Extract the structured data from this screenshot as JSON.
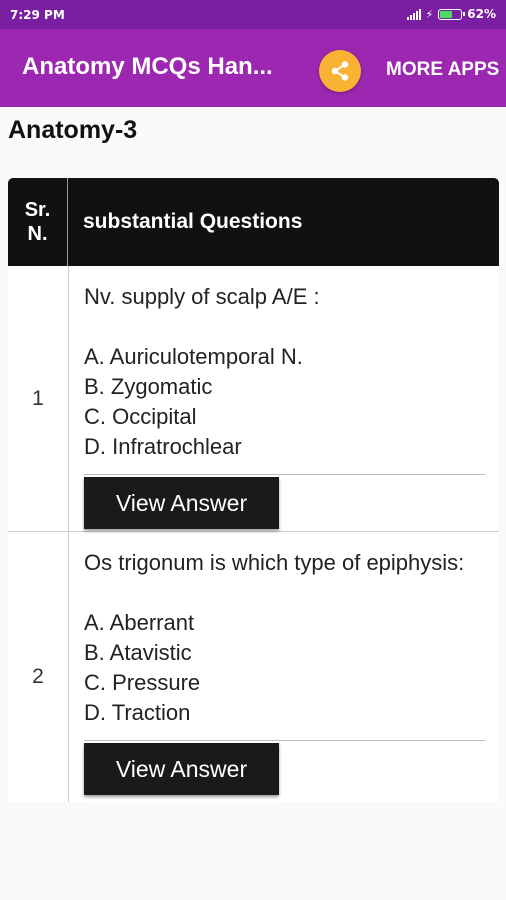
{
  "status_bar": {
    "time": "7:29 PM",
    "battery": "62%",
    "battery_level": 0.62
  },
  "app_bar": {
    "title": "Anatomy MCQs Han...",
    "share_icon": "share-icon",
    "more_apps_label": "MORE APPS"
  },
  "page": {
    "heading": "Anatomy-3"
  },
  "table": {
    "headers": {
      "sr": "Sr. N.",
      "question": "substantial Questions"
    },
    "rows": [
      {
        "number": "1",
        "question": "Nv. supply of scalp A/E :",
        "options": [
          "A. Auriculotemporal N.",
          "B. Zygomatic",
          "C. Occipital",
          "D. Infratrochlear"
        ],
        "button_label": "View Answer"
      },
      {
        "number": "2",
        "question": "Os trigonum is which type of epiphysis:",
        "options": [
          "A. Aberrant",
          "B. Atavistic",
          "C. Pressure",
          "D. Traction"
        ],
        "button_label": "View Answer"
      }
    ]
  },
  "colors": {
    "status_bar": "#7b1fa2",
    "app_bar": "#9c27b0",
    "share_button": "#f9b233",
    "table_header": "#111111",
    "button": "#1a1a1a"
  }
}
